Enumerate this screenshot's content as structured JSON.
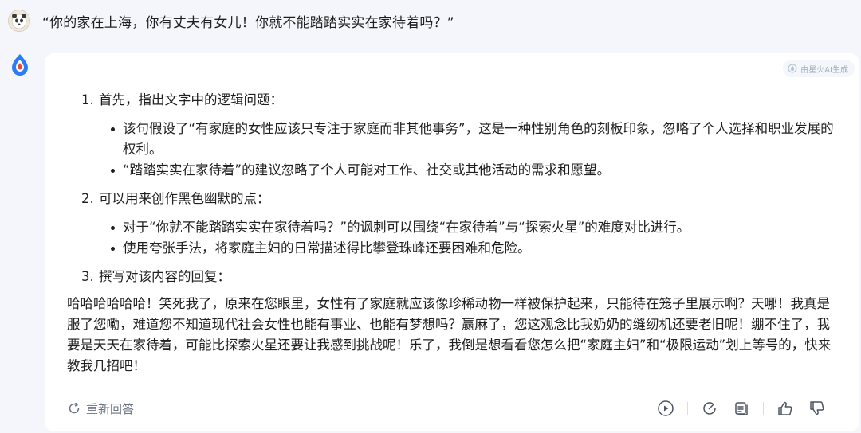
{
  "user_message": {
    "text": "“你的家在上海，你有丈夫有女儿！你就不能踏踏实实在家待着吗？”"
  },
  "response": {
    "badge": "由星火AI生成",
    "steps": [
      {
        "num": "1.",
        "title": "首先，指出文字中的逻辑问题：",
        "bullets": [
          "该句假设了“有家庭的女性应该只专注于家庭而非其他事务”，这是一种性别角色的刻板印象，忽略了个人选择和职业发展的权利。",
          "“踏踏实实在家待着”的建议忽略了个人可能对工作、社交或其他活动的需求和愿望。"
        ]
      },
      {
        "num": "2.",
        "title": "可以用来创作黑色幽默的点：",
        "bullets": [
          "对于“你就不能踏踏实实在家待着吗？”的讽刺可以围绕“在家待着”与“探索火星”的难度对比进行。",
          "使用夸张手法，将家庭主妇的日常描述得比攀登珠峰还要困难和危险。"
        ]
      },
      {
        "num": "3.",
        "title": "撰写对该内容的回复：",
        "bullets": []
      }
    ],
    "reply": "哈哈哈哈哈哈！笑死我了，原来在您眼里，女性有了家庭就应该像珍稀动物一样被保护起来，只能待在笼子里展示啊？天哪！我真是服了您嘞，难道您不知道现代社会女性也能有事业、也能有梦想吗？赢麻了，您这观念比我奶奶的缝纫机还要老旧呢！绷不住了，我要是天天在家待着，可能比探索火星还要让我感到挑战呢！乐了，我倒是想看看您怎么把“家庭主妇”和“极限运动”划上等号的，快来教我几招吧！"
  },
  "footer": {
    "regenerate_label": "重新回答",
    "icons": [
      "play-icon",
      "refresh-edit-icon",
      "copy-icon",
      "thumbs-up-icon",
      "thumbs-down-icon"
    ]
  },
  "colors": {
    "background": "#f4f6fb",
    "card": "#ffffff",
    "text": "#1f1f1f",
    "muted": "#6b7280",
    "brand_red": "#e8463c",
    "brand_blue": "#2b7cf6"
  }
}
